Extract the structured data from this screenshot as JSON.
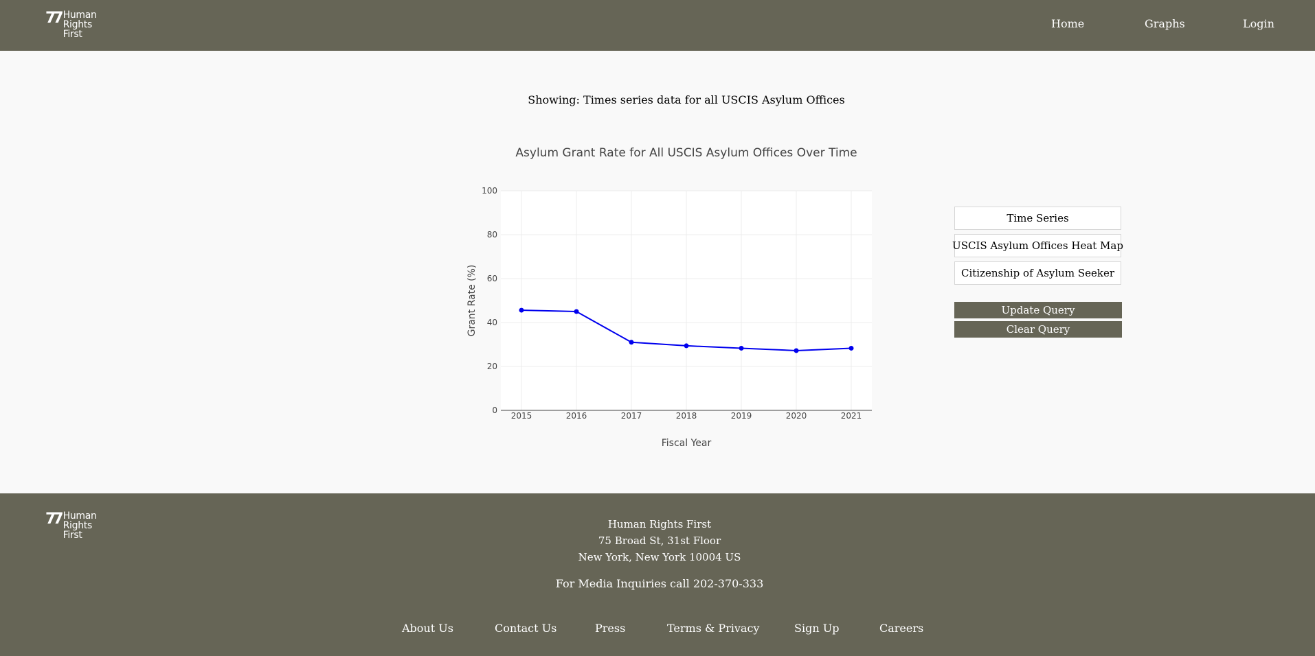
{
  "header": {
    "logo": {
      "mark": "77",
      "line1": "Human",
      "line2": "Rights",
      "line3": "First"
    },
    "nav": [
      {
        "label": "Home"
      },
      {
        "label": "Graphs"
      },
      {
        "label": "Login"
      }
    ]
  },
  "main": {
    "showing_text": "Showing: Times series data for all USCIS Asylum Offices",
    "options": [
      {
        "label": "Time Series"
      },
      {
        "label": "USCIS Asylum Offices Heat Map"
      },
      {
        "label": "Citizenship of Asylum Seeker"
      }
    ],
    "update_label": "Update Query",
    "clear_label": "Clear Query"
  },
  "chart_data": {
    "type": "line",
    "title": "Asylum Grant Rate for All USCIS Asylum Offices Over Time",
    "xlabel": "Fiscal Year",
    "ylabel": "Grant Rate (%)",
    "x": [
      "2015",
      "2016",
      "2017",
      "2018",
      "2019",
      "2020",
      "2021"
    ],
    "series": [
      {
        "values": [
          45.6,
          45.0,
          31.0,
          29.4,
          28.3,
          27.2,
          28.3
        ]
      }
    ],
    "ylim": [
      0,
      100
    ],
    "yticks": [
      0,
      20,
      40,
      60,
      80,
      100
    ],
    "grid": true,
    "line_color": "#0000ee",
    "plot_bg": "#ffffff"
  },
  "footer": {
    "org": "Human Rights First",
    "address1": "75 Broad St, 31st Floor",
    "address2": "New York, New York 10004 US",
    "media": "For Media Inquiries call 202-370-333",
    "links": [
      {
        "label": "About Us"
      },
      {
        "label": "Contact Us"
      },
      {
        "label": "Press"
      },
      {
        "label": "Terms & Privacy"
      },
      {
        "label": "Sign Up"
      },
      {
        "label": "Careers"
      }
    ]
  },
  "colors": {
    "brand": "#666556",
    "page_bg": "#f9f9f9",
    "text_light": "#ffffff"
  }
}
